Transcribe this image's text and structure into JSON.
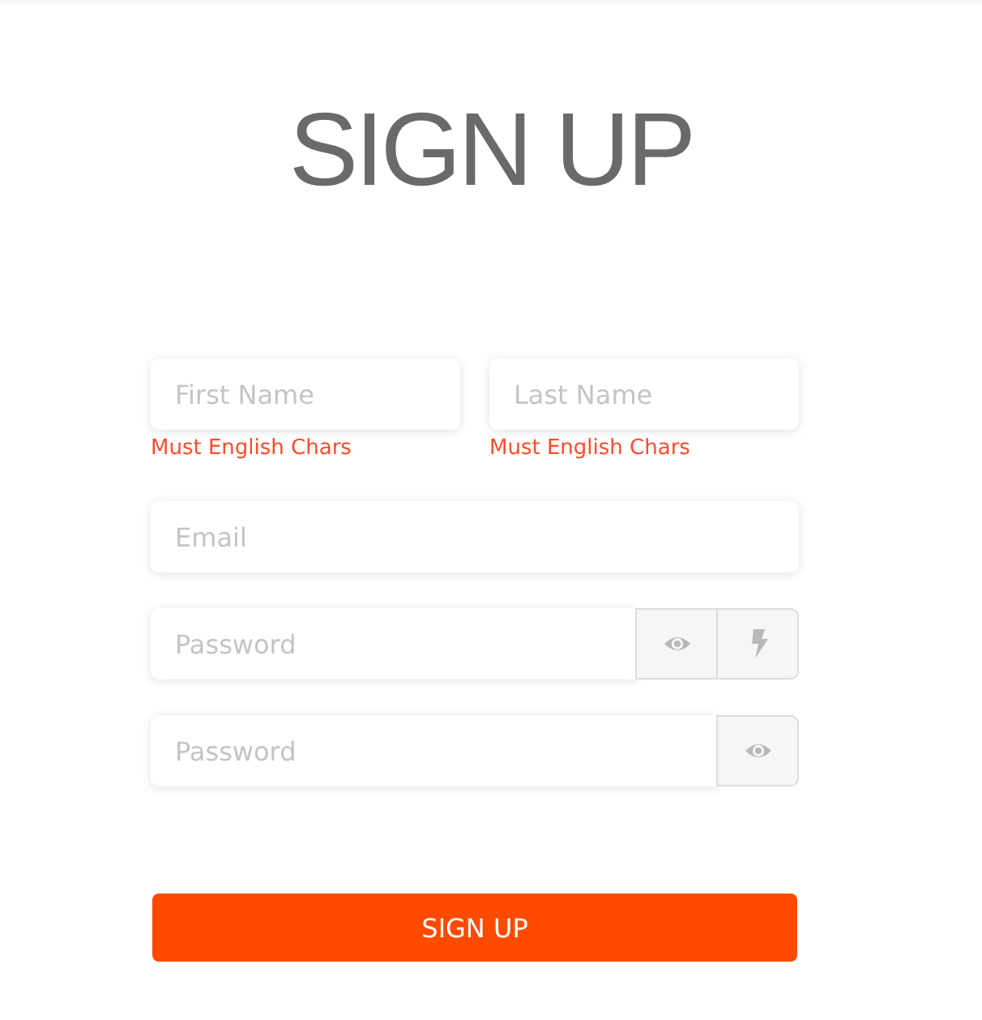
{
  "title": "SIGN UP",
  "name_fields": [
    {
      "placeholder": "First Name",
      "error": "Must English Chars"
    },
    {
      "placeholder": "Last Name",
      "error": "Must English Chars"
    }
  ],
  "fields": [
    {
      "placeholder": "Email"
    },
    {
      "placeholder": "Password",
      "addons": [
        {
          "kind": "show"
        },
        {
          "kind": "generate"
        }
      ]
    },
    {
      "placeholder": "Password",
      "addons": [
        {
          "kind": "show"
        }
      ]
    }
  ],
  "submit": {
    "label": "SIGN UP"
  }
}
